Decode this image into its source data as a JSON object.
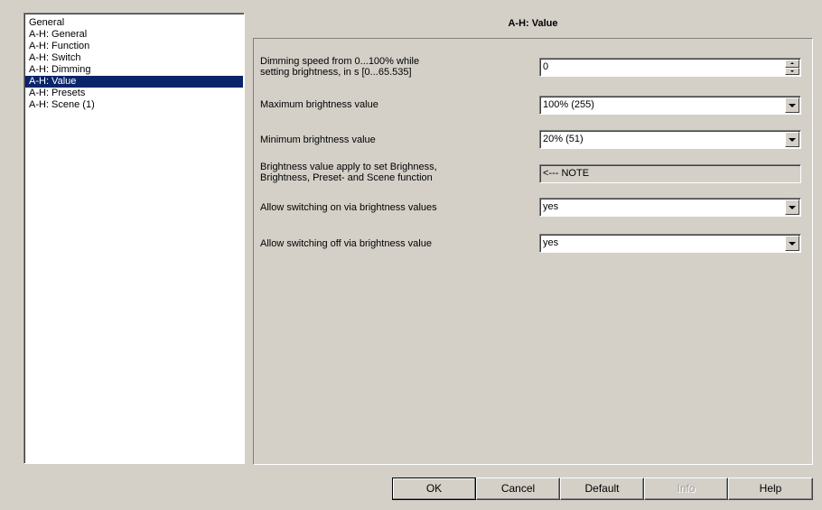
{
  "sidebar": {
    "items": [
      {
        "label": "General"
      },
      {
        "label": "A-H: General"
      },
      {
        "label": "A-H: Function"
      },
      {
        "label": "A-H: Switch"
      },
      {
        "label": "A-H: Dimming"
      },
      {
        "label": "A-H: Value"
      },
      {
        "label": "A-H: Presets"
      },
      {
        "label": "A-H: Scene (1)"
      }
    ],
    "selected": "A-H: Value"
  },
  "panel": {
    "title": "A-H: Value",
    "rows": [
      {
        "label_line1": "Dimming speed from 0...100% while",
        "label_line2": "setting brightness, in s [0...65.535]",
        "value": "0",
        "control": "spinner"
      },
      {
        "label": "Maximum brightness value",
        "value": "100% (255)",
        "control": "dropdown"
      },
      {
        "label": "Minimum brightness value",
        "value": "20%  (51)",
        "control": "dropdown"
      },
      {
        "label_line1": "Brightness value apply to set Brighness,",
        "label_line2": "Brightness, Preset- and Scene function",
        "value": "<--- NOTE",
        "control": "readonly"
      },
      {
        "label": "Allow switching on via brightness values",
        "value": "yes",
        "control": "dropdown"
      },
      {
        "label": "Allow switching off via brightness value",
        "value": "yes",
        "control": "dropdown"
      }
    ]
  },
  "buttons": {
    "ok": "OK",
    "cancel": "Cancel",
    "default": "Default",
    "info": "Info",
    "help": "Help"
  },
  "icons": {
    "dropdown": "chevron-down-icon",
    "spin_up": "spin-up-icon",
    "spin_down": "spin-down-icon"
  },
  "colors": {
    "selection": "#0a246a",
    "window": "#d4d0c8"
  }
}
